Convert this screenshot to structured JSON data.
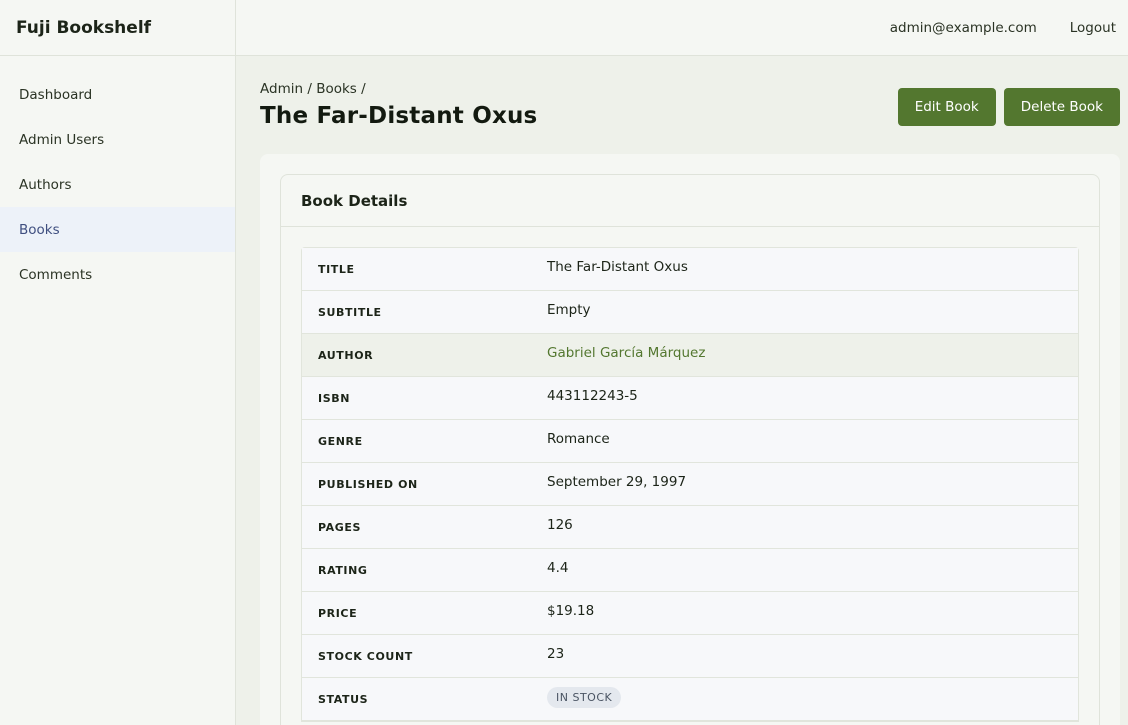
{
  "app": {
    "brand": "Fuji Bookshelf"
  },
  "sidebar": {
    "items": [
      {
        "label": "Dashboard"
      },
      {
        "label": "Admin Users"
      },
      {
        "label": "Authors"
      },
      {
        "label": "Books",
        "active": true
      },
      {
        "label": "Comments"
      }
    ]
  },
  "topbar": {
    "user_email": "admin@example.com",
    "logout_label": "Logout"
  },
  "breadcrumb": {
    "admin": "Admin",
    "books": "Books",
    "sep": "/"
  },
  "page": {
    "title": "The Far-Distant Oxus"
  },
  "actions": {
    "edit_label": "Edit Book",
    "delete_label": "Delete Book"
  },
  "card": {
    "header": "Book Details"
  },
  "details": {
    "title": {
      "label": "TITLE",
      "value": "The Far-Distant Oxus"
    },
    "subtitle": {
      "label": "SUBTITLE",
      "value": "Empty"
    },
    "author": {
      "label": "AUTHOR",
      "value": "Gabriel García Márquez"
    },
    "isbn": {
      "label": "ISBN",
      "value": "443112243-5"
    },
    "genre": {
      "label": "GENRE",
      "value": "Romance"
    },
    "published_on": {
      "label": "PUBLISHED ON",
      "value": "September 29, 1997"
    },
    "pages": {
      "label": "PAGES",
      "value": "126"
    },
    "rating": {
      "label": "RATING",
      "value": "4.4"
    },
    "price": {
      "label": "PRICE",
      "value": "$19.18"
    },
    "stock_count": {
      "label": "STOCK COUNT",
      "value": "23"
    },
    "status": {
      "label": "STATUS",
      "value": "IN STOCK"
    }
  },
  "colors": {
    "accent": "#53772f",
    "active_nav": "#3f4f80",
    "background": "#eef1ea"
  }
}
